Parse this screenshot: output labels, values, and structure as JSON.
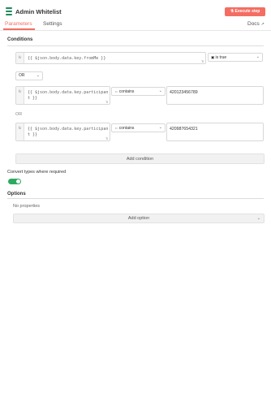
{
  "header": {
    "title": "Admin Whitelist",
    "execute_label": "Execute step",
    "tabs": [
      "Parameters",
      "Settings"
    ],
    "docs_label": "Docs",
    "node_icon": "stack-icon"
  },
  "conditions": {
    "label": "Conditions",
    "first": {
      "fx": "fx",
      "expression": "{{ $json.body.data.key.fromMe }}",
      "type_tag": "Ti",
      "operator": "is true"
    },
    "combinator": "OR",
    "rows": [
      {
        "fx": "fx",
        "expression_line1": "{{ $json.body.data.key.participan",
        "expression_line2": "t }}",
        "type_tag": "Ti",
        "operator": "contains",
        "value": "420123456789"
      },
      {
        "fx": "fx",
        "expression_line1": "{{ $json.body.data.key.participan",
        "expression_line2": "t }}",
        "type_tag": "Ti",
        "operator": "contains",
        "value": "420987654321"
      }
    ],
    "or_separator": "OR",
    "add_condition": "Add condition"
  },
  "convert": {
    "label": "Convert types where required",
    "enabled": true,
    "accent": "#2daa5f"
  },
  "options": {
    "label": "Options",
    "empty_text": "No properties",
    "add_option": "Add option"
  },
  "colors": {
    "accent": "#f46d62",
    "toggle_on": "#2daa5f",
    "logo": "#1f8a5c"
  }
}
